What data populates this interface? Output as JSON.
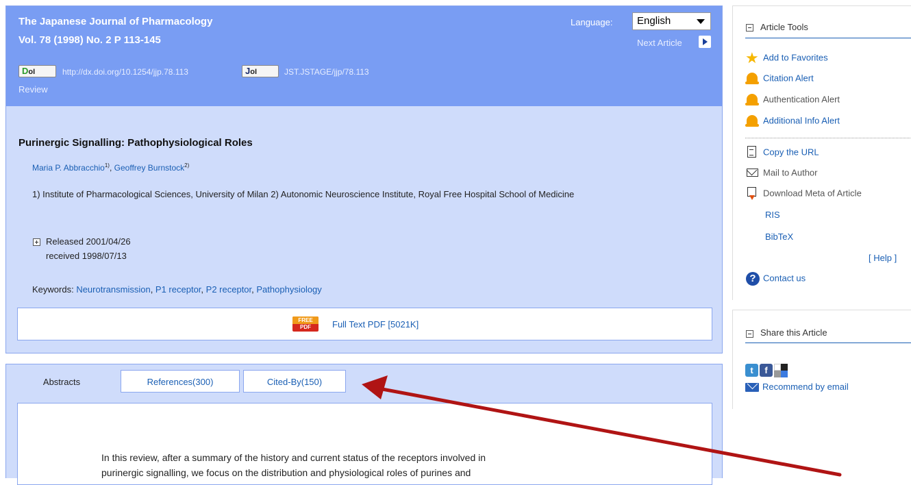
{
  "header": {
    "journal_name": "The Japanese Journal of Pharmacology",
    "volume_info": "Vol. 78 (1998) No. 2 P 113-145",
    "language_label": "Language:",
    "language_value": "English",
    "next_article": "Next Article",
    "doi_badge_prefix": "D",
    "doi_badge_suffix": "oI",
    "doi_link": "http://dx.doi.org/10.1254/jjp.78.113",
    "jol_badge_prefix": "J",
    "jol_badge_suffix": "oI",
    "jol_link": "JST.JSTAGE/jjp/78.113",
    "article_type": "Review"
  },
  "article": {
    "title": "Purinergic Signalling: Pathophysiological Roles",
    "authors": [
      {
        "name": "Maria P. Abbracchio",
        "sup": "1)"
      },
      {
        "name": "Geoffrey Burnstock",
        "sup": "2)"
      }
    ],
    "author_separator": ", ",
    "affiliations": "1) Institute of Pharmacological Sciences, University of Milan 2) Autonomic Neuroscience Institute, Royal Free Hospital School of Medicine",
    "released": "Released 2001/04/26",
    "received": "received 1998/07/13",
    "keywords_label": "Keywords: ",
    "keywords": [
      "Neurotransmission",
      "P1 receptor",
      "P2 receptor",
      "Pathophysiology"
    ],
    "free_icon_top": "FREE",
    "free_icon_bottom": "PDF",
    "full_text_link": "Full Text PDF [5021K]"
  },
  "tabs": [
    {
      "label": "Abstracts",
      "active": true
    },
    {
      "label": "References(300)",
      "active": false
    },
    {
      "label": "Cited-By(150)",
      "active": false
    }
  ],
  "abstract": {
    "line1": "In this review, after a summary of the history and current status of the receptors involved in",
    "line2": "purinergic signalling, we focus on the distribution and physiological roles of purines and"
  },
  "sidebar": {
    "tools_title": "Article Tools",
    "tools": {
      "add_favorites": "Add to Favorites",
      "citation_alert": "Citation Alert",
      "authentication_alert": "Authentication Alert",
      "additional_info_alert": "Additional Info Alert",
      "copy_url": "Copy the URL",
      "mail_author": "Mail to Author",
      "download_meta": "Download Meta of Article",
      "ris": "RIS",
      "bibtex": "BibTeX",
      "help": "[ Help ]",
      "contact_us": "Contact us"
    },
    "share_title": "Share this Article",
    "recommend": "Recommend by email"
  },
  "colors": {
    "header_band": "#799df3",
    "panel_bg": "#cfdcfb",
    "link": "#1a5fb4",
    "annotation_arrow": "#b01414"
  }
}
